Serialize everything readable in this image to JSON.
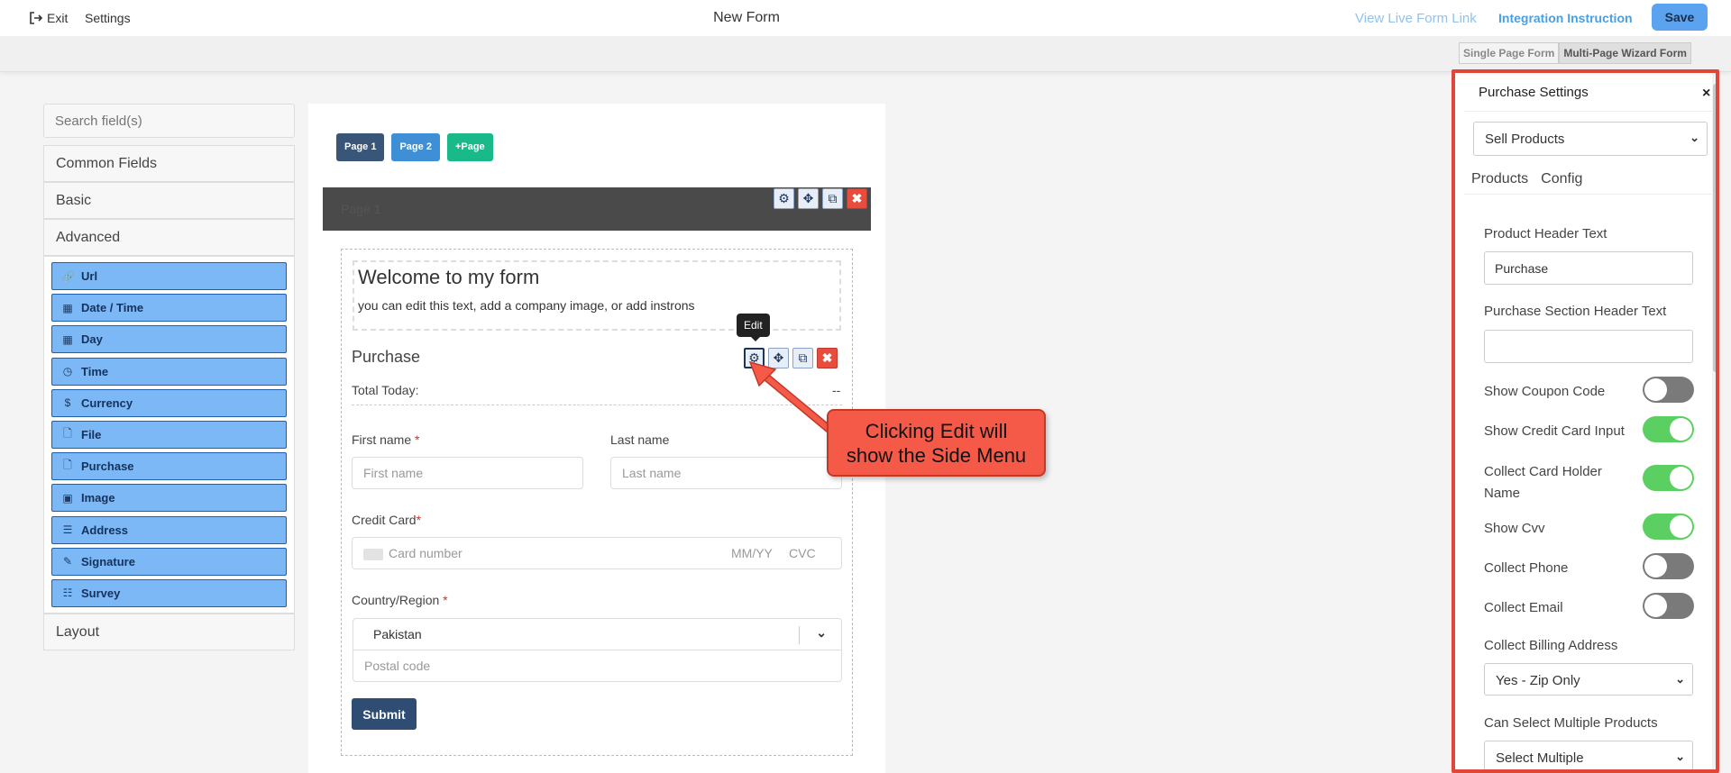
{
  "topbar": {
    "exit_label": "Exit",
    "settings_label": "Settings",
    "title": "New Form",
    "live_link": "View Live Form Link",
    "integration_link": "Integration Instruction",
    "save_label": "Save"
  },
  "form_type_tabs": {
    "single": "Single Page Form",
    "multi": "Multi-Page Wizard Form"
  },
  "sidebar": {
    "search_placeholder": "Search field(s)",
    "sections": {
      "common": "Common Fields",
      "basic": "Basic",
      "advanced": "Advanced",
      "layout": "Layout"
    },
    "advanced_fields": [
      {
        "label": "Url",
        "icon": "🔗"
      },
      {
        "label": "Date / Time",
        "icon": "▦"
      },
      {
        "label": "Day",
        "icon": "▦"
      },
      {
        "label": "Time",
        "icon": "◷"
      },
      {
        "label": "Currency",
        "icon": "$"
      },
      {
        "label": "File",
        "icon": "🗋"
      },
      {
        "label": "Purchase",
        "icon": "🗋"
      },
      {
        "label": "Image",
        "icon": "▣"
      },
      {
        "label": "Address",
        "icon": "☰"
      },
      {
        "label": "Signature",
        "icon": "✎"
      },
      {
        "label": "Survey",
        "icon": "☷"
      }
    ]
  },
  "pages": {
    "page1": "Page 1",
    "page2": "Page 2",
    "add_page": "+Page",
    "bar_label": "Page 1"
  },
  "form": {
    "welcome_heading": "Welcome to my form",
    "welcome_sub": "you can edit this text, add a company image, or add instrons",
    "purchase_title": "Purchase",
    "total_label": "Total Today:",
    "total_value": "--",
    "first_name_label": "First name",
    "first_name_placeholder": "First name",
    "last_name_label": "Last name",
    "last_name_placeholder": "Last name",
    "credit_card_label": "Credit Card",
    "card_number_placeholder": "Card number",
    "card_expiry_placeholder": "MM/YY",
    "card_cvc_placeholder": "CVC",
    "country_label": "Country/Region",
    "country_value": "Pakistan",
    "postal_placeholder": "Postal code",
    "submit_label": "Submit",
    "required_mark": "*"
  },
  "tooltip": "Edit",
  "callout": {
    "line1": "Clicking Edit will",
    "line2": "show the Side Menu"
  },
  "panel": {
    "title": "Purchase Settings",
    "close": "×",
    "mode_select": "Sell Products",
    "tabs": [
      "Products",
      "Config"
    ],
    "product_header_label": "Product Header Text",
    "product_header_value": "Purchase",
    "section_header_label": "Purchase Section Header Text",
    "section_header_value": "",
    "toggles": [
      {
        "label": "Show Coupon Code",
        "on": false
      },
      {
        "label": "Show Credit Card Input",
        "on": true
      },
      {
        "label": "Collect Card Holder Name",
        "on": true
      },
      {
        "label": "Show Cvv",
        "on": true
      },
      {
        "label": "Collect Phone",
        "on": false
      },
      {
        "label": "Collect Email",
        "on": false
      }
    ],
    "billing_label": "Collect Billing Address",
    "billing_value": "Yes - Zip Only",
    "multiple_label": "Can Select Multiple Products",
    "multiple_value": "Select Multiple"
  },
  "colors": {
    "accent": "#5ba3ee",
    "field_button": "#7bb8f5",
    "callout": "#f55a48",
    "toggle_on": "#5ccf62",
    "toggle_off": "#7a7a7a",
    "panel_border": "#e2453a"
  }
}
